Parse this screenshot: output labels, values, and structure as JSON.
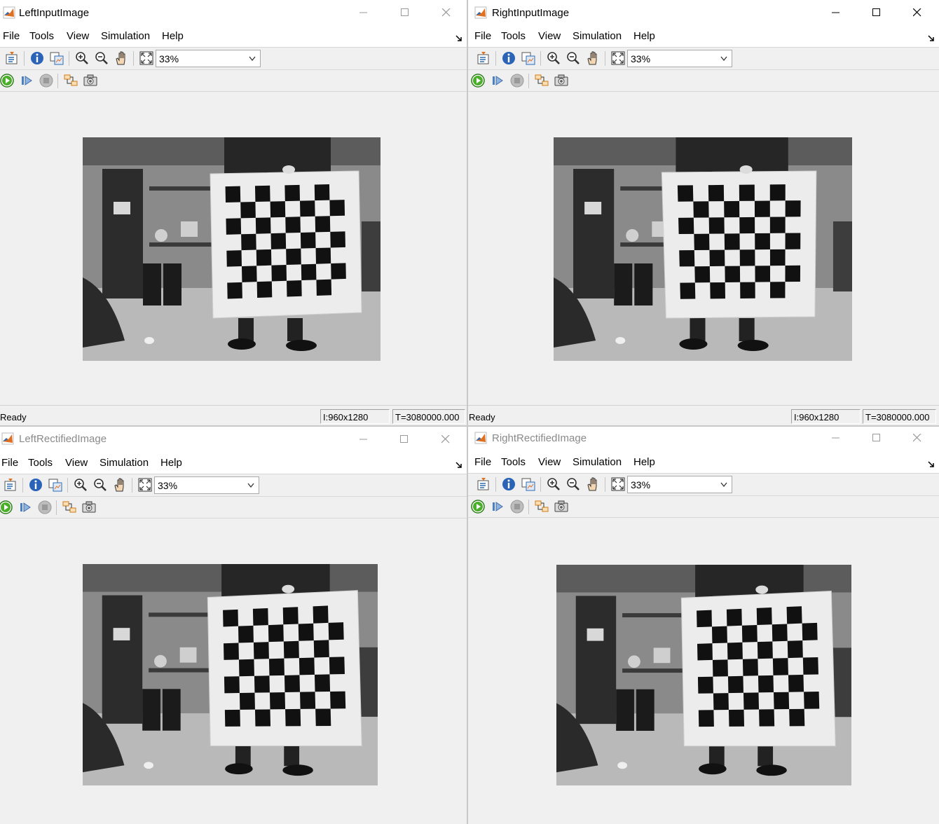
{
  "windows": [
    {
      "id": "left-input",
      "title": "LeftInputImage",
      "active": true,
      "menu": [
        "File",
        "Tools",
        "View",
        "Simulation",
        "Help"
      ],
      "zoom": "33%",
      "status": {
        "text": "Ready",
        "dims": "I:960x1280",
        "time": "T=3080000.000"
      },
      "board_tilt": "keystone-left"
    },
    {
      "id": "right-input",
      "title": "RightInputImage",
      "active": true,
      "menu": [
        "File",
        "Tools",
        "View",
        "Simulation",
        "Help"
      ],
      "zoom": "33%",
      "status": {
        "text": "Ready",
        "dims": "I:960x1280",
        "time": "T=3080000.000"
      },
      "board_tilt": "keystone-right"
    },
    {
      "id": "left-rectified",
      "title": "LeftRectifiedImage",
      "active": false,
      "menu": [
        "File",
        "Tools",
        "View",
        "Simulation",
        "Help"
      ],
      "zoom": "33%",
      "status": null,
      "board_tilt": "rectified"
    },
    {
      "id": "right-rectified",
      "title": "RightRectifiedImage",
      "active": false,
      "menu": [
        "File",
        "Tools",
        "View",
        "Simulation",
        "Help"
      ],
      "zoom": "33%",
      "status": null,
      "board_tilt": "rectified"
    }
  ],
  "toolbar_icons": {
    "row1": [
      "parameters-icon",
      "info-icon",
      "export-image-icon",
      "zoom-in-icon",
      "zoom-out-icon",
      "pan-hand-icon",
      "fit-to-window-icon"
    ],
    "row2": [
      "run-icon",
      "step-forward-icon",
      "stop-icon",
      "highlight-simulink-block-icon",
      "snapshot-camera-icon"
    ]
  },
  "colors": {
    "matlab_orange": "#e07020",
    "run_green": "#4caf2a",
    "board_white": "#ececec",
    "square_black": "#111111"
  }
}
